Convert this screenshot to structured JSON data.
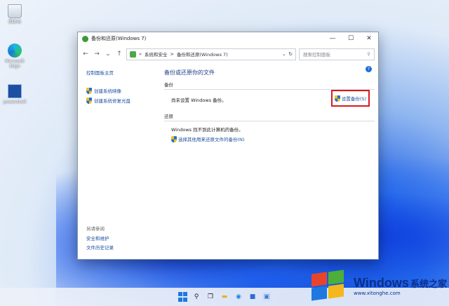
{
  "desktop": {
    "icons": [
      {
        "label": "回收站",
        "icon": "recycle-bin-icon"
      },
      {
        "label": "Microsoft Edge",
        "icon": "edge-icon"
      },
      {
        "label": "powershell",
        "icon": "powershell-icon"
      }
    ]
  },
  "window": {
    "title": "备份和还原(Windows 7)",
    "controls": {
      "minimize": "—",
      "maximize": "☐",
      "close": "✕"
    },
    "toolbar": {
      "back": "←",
      "forward": "→",
      "dropdown": "⌄",
      "up": "↑",
      "breadcrumb_sep": "«",
      "crumb1": "系统和安全",
      "crumb_arrow": ">",
      "crumb2": "备份和还原(Windows 7)",
      "address_dropdown": "⌄",
      "refresh": "↻",
      "search_placeholder": "搜索控制面板",
      "search_icon": "⚲"
    },
    "sidebar": {
      "home": "控制面板主页",
      "links": [
        "创建系统映像",
        "创建系统修复光盘"
      ],
      "see_also": "另请参阅",
      "bottom_links": [
        "安全和维护",
        "文件历史记录"
      ]
    },
    "main": {
      "title": "备份或还原你的文件",
      "backup_label": "备份",
      "backup_status": "尚未设置 Windows 备份。",
      "setup_button": "设置备份(S)",
      "restore_label": "还原",
      "restore_status": "Windows 找不到此计算机的备份。",
      "restore_link": "选择其他用来还原文件的备份(N)",
      "help": "?"
    }
  },
  "taskbar": {
    "search": "⚲",
    "taskview": "❐",
    "folder": "▬",
    "edge": "◉",
    "store": "■",
    "control_panel": "▣"
  },
  "watermark": {
    "title": "Windows",
    "title_cn": "系统之家",
    "url": "www.xitonghe.com"
  },
  "colors": {
    "link": "#1a4f9c",
    "highlight_border": "#d8191f",
    "heading": "#1e3f8a"
  }
}
